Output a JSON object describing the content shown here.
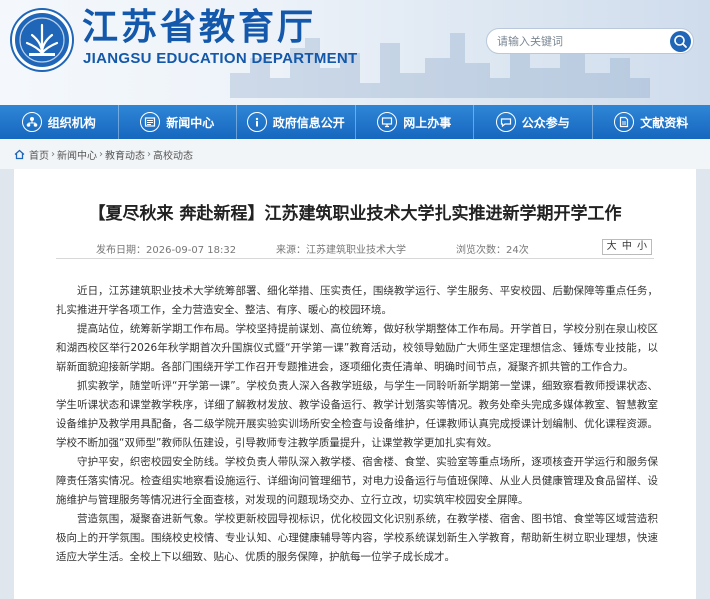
{
  "header": {
    "logo_cn": "江苏省教育厅",
    "logo_en": "JIANGSU EDUCATION DEPARTMENT",
    "search_placeholder": "请输入关键词"
  },
  "nav": {
    "items": [
      {
        "label": "组织机构",
        "icon": "org-icon"
      },
      {
        "label": "新闻中心",
        "icon": "news-icon"
      },
      {
        "label": "政府信息公开",
        "icon": "info-icon"
      },
      {
        "label": "网上办事",
        "icon": "online-service-icon"
      },
      {
        "label": "公众参与",
        "icon": "public-icon"
      },
      {
        "label": "文献资料",
        "icon": "document-icon"
      }
    ]
  },
  "breadcrumb": [
    "首页",
    "新闻中心",
    "教育动态",
    "高校动态"
  ],
  "article": {
    "title": "【夏尽秋来 奔赴新程】江苏建筑职业技术大学扎实推进新学期开学工作",
    "date": "发布日期：2026-09-07 18:32",
    "source": "来源：江苏建筑职业技术大学",
    "views": "浏览次数：24次",
    "font_sizes": [
      "大",
      "中",
      "小"
    ],
    "paragraphs": [
      "近日，江苏建筑职业技术大学统筹部署、细化举措、压实责任，围绕教学运行、学生服务、平安校园、后勤保障等重点任务，扎实推进开学各项工作，全力营造安全、整洁、有序、暖心的校园环境。",
      "提高站位，统筹新学期工作布局。学校坚持提前谋划、高位统筹，做好秋学期整体工作布局。开学首日，学校分别在泉山校区和湖西校区举行2026年秋学期首次升国旗仪式暨“开学第一课”教育活动，校领导勉励广大师生坚定理想信念、锤炼专业技能，以崭新面貌迎接新学期。各部门围绕开学工作召开专题推进会，逐项细化责任清单、明确时间节点，凝聚齐抓共管的工作合力。",
      "抓实教学，随堂听评“开学第一课”。学校负责人深入各教学班级，与学生一同聆听新学期第一堂课，细致察看教师授课状态、学生听课状态和课堂教学秩序，详细了解教材发放、教学设备运行、教学计划落实等情况。教务处牵头完成多媒体教室、智慧教室设备维护及教学用具配备，各二级学院开展实验实训场所安全检查与设备维护，任课教师认真完成授课计划编制、优化课程资源。学校不断加强“双师型”教师队伍建设，引导教师专注教学质量提升，让课堂教学更加扎实有效。",
      "守护平安，织密校园安全防线。学校负责人带队深入教学楼、宿舍楼、食堂、实验室等重点场所，逐项核查开学运行和服务保障责任落实情况。检查组实地察看设施运行、详细询问管理细节，对电力设备运行与值班保障、从业人员健康管理及食品留样、设施维护与管理服务等情况进行全面查核，对发现的问题现场交办、立行立改，切实筑牢校园安全屏障。",
      "营造氛围，凝聚奋进新气象。学校更新校园导视标识，优化校园文化识别系统，在教学楼、宿舍、图书馆、食堂等区域营造积极向上的开学氛围。围绕校史校情、专业认知、心理健康辅导等内容，学校系统谋划新生入学教育，帮助新生树立职业理想，快速适应大学生活。全校上下以细致、贴心、优质的服务保障，护航每一位学子成长成才。"
    ]
  },
  "colors": {
    "brand_blue": "#1358aa",
    "nav_blue": "#1f74cc",
    "page_bg": "#dfe6ee"
  }
}
